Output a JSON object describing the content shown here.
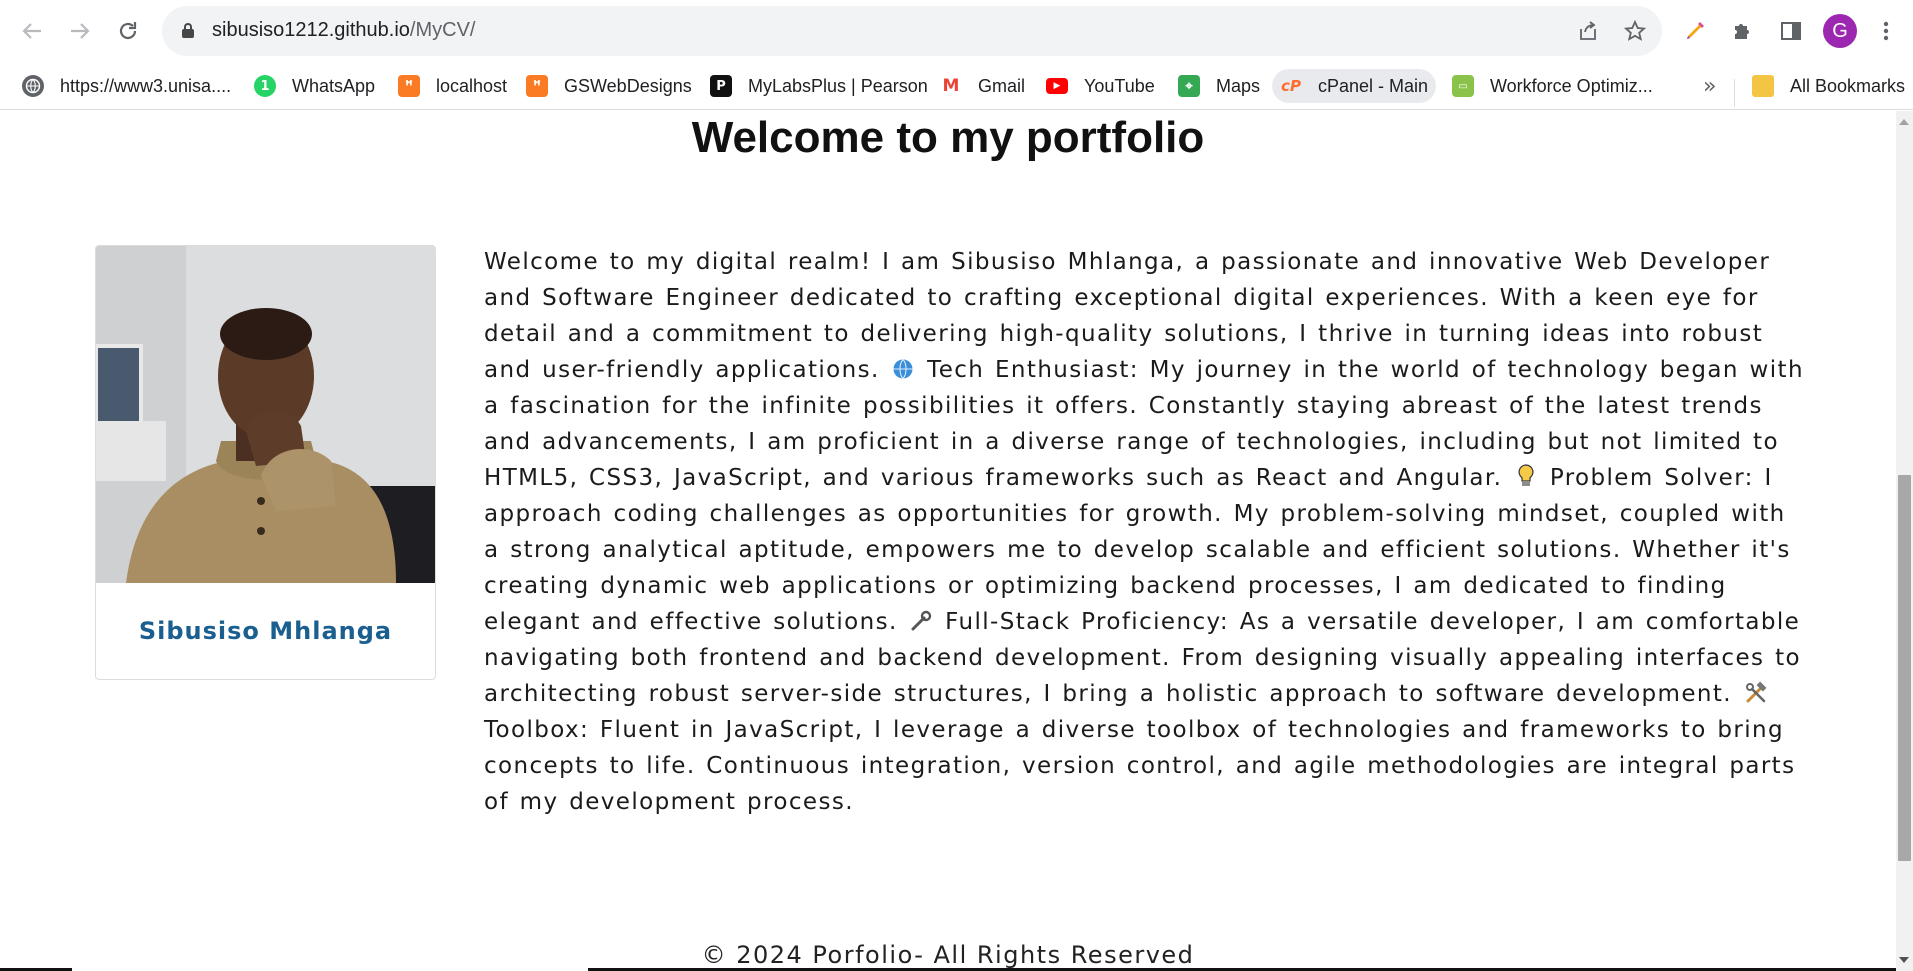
{
  "browser": {
    "url_host": "sibusiso1212.github.io",
    "url_path": "/MyCV/",
    "profile_initial": "G",
    "bookmarks": [
      {
        "label": "https://www3.unisa....",
        "icon": "globe-icon"
      },
      {
        "label": "WhatsApp",
        "icon": "whatsapp-icon",
        "color": "#25d366",
        "glyph": "1"
      },
      {
        "label": "localhost",
        "icon": "xampp-icon",
        "color": "#fb7a24",
        "glyph": "ꟸ"
      },
      {
        "label": "GSWebDesigns",
        "icon": "xampp-icon",
        "color": "#fb7a24",
        "glyph": "ꟸ"
      },
      {
        "label": "MyLabsPlus | Pearson",
        "icon": "pearson-icon",
        "color": "#111111",
        "glyph": "P"
      },
      {
        "label": "Gmail",
        "icon": "gmail-icon",
        "color": "#ea4335",
        "glyph": "M"
      },
      {
        "label": "YouTube",
        "icon": "youtube-icon",
        "color": "#ff0000",
        "glyph": "▶"
      },
      {
        "label": "Maps",
        "icon": "maps-icon",
        "color": "#34a853",
        "glyph": "⌖"
      },
      {
        "label": "cPanel - Main",
        "icon": "cpanel-icon",
        "color": "#ff6c2c",
        "glyph": "cP"
      },
      {
        "label": "Workforce Optimiz...",
        "icon": "chat-icon",
        "color": "#8bc34a",
        "glyph": "▭"
      }
    ],
    "overflow": "»",
    "all_bookmarks": "All Bookmarks"
  },
  "page": {
    "title": "Welcome to my portfolio",
    "profile_name": "Sibusiso Mhlanga",
    "bio": {
      "intro": "Welcome to my digital realm! I am Sibusiso Mhlanga, a passionate and innovative Web Developer and Software Engineer dedicated to crafting exceptional digital experiences. With a keen eye for detail and a commitment to delivering high-quality solutions, I thrive in turning ideas into robust and user-friendly applications.",
      "tech": "Tech Enthusiast: My journey in the world of technology began with a fascination for the infinite possibilities it offers. Constantly staying abreast of the latest trends and advancements, I am proficient in a diverse range of technologies, including but not limited to HTML5, CSS3, JavaScript, and various frameworks such as React and Angular.",
      "problem": "Problem Solver: I approach coding challenges as opportunities for growth. My problem-solving mindset, coupled with a strong analytical aptitude, empowers me to develop scalable and efficient solutions. Whether it's creating dynamic web applications or optimizing backend processes, I am dedicated to finding elegant and effective solutions.",
      "fullstack": "Full-Stack Proficiency: As a versatile developer, I am comfortable navigating both frontend and backend development. From designing visually appealing interfaces to architecting robust server-side structures, I bring a holistic approach to software development.",
      "toolbox": "Toolbox: Fluent in JavaScript, I leverage a diverse toolbox of technologies and frameworks to bring concepts to life. Continuous integration, version control, and agile methodologies are integral parts of my development process."
    },
    "footer": "© 2024 Porfolio- All Rights Reserved"
  }
}
